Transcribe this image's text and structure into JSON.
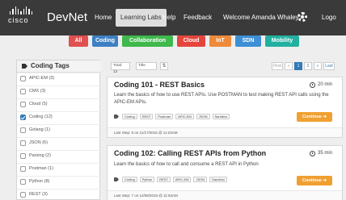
{
  "header": {
    "brand": "DevNet",
    "logo_text": "cisco",
    "nav": [
      "Home",
      "Learning Labs",
      "Help",
      "Feedback"
    ],
    "active_nav": "Learning Labs",
    "welcome": "Welcome Amanda Whaley",
    "logout": "Logo"
  },
  "categories": [
    {
      "label": "All",
      "color": "#e05050"
    },
    {
      "label": "Coding",
      "color": "#3d7fc4"
    },
    {
      "label": "Collaboration",
      "color": "#3fb84c"
    },
    {
      "label": "Cloud",
      "color": "#e5453d"
    },
    {
      "label": "IoT",
      "color": "#ef8a3a"
    },
    {
      "label": "SDN",
      "color": "#3d8fd6"
    },
    {
      "label": "Mobility",
      "color": "#22b0a0"
    }
  ],
  "sidebar": {
    "title": "Coding Tags",
    "items": [
      {
        "label": "APIC-EM (3)",
        "checked": false
      },
      {
        "label": "CMX (3)",
        "checked": false
      },
      {
        "label": "Cloud (5)",
        "checked": false
      },
      {
        "label": "Coding (12)",
        "checked": true
      },
      {
        "label": "Golang (1)",
        "checked": false
      },
      {
        "label": "JSON (6)",
        "checked": false
      },
      {
        "label": "Parsing (2)",
        "checked": false
      },
      {
        "label": "Postman (1)",
        "checked": false
      },
      {
        "label": "Python (8)",
        "checked": false
      },
      {
        "label": "REST (3)",
        "checked": false
      }
    ]
  },
  "toolbar": {
    "total": "Total: 12",
    "sort_select": "Title",
    "sort_icon": "⇅",
    "pagination": [
      "First",
      "«",
      "1",
      "2",
      "»",
      "Last"
    ],
    "current_page": "1"
  },
  "labs": [
    {
      "title": "Coding 101 - REST Basics",
      "duration": "20 min",
      "description": "Learn the basics of how to use REST APIs. Use POSTMAN to test making REST API calls using the APIC-EM APIs.",
      "tags": [
        "Coding",
        "REST",
        "Postman",
        "APIC-EM",
        "JSON",
        "Sandbox"
      ],
      "button": "Continue ➜",
      "last_step": "Last Step: 8 on 11/17/2015 @ 11:23AM"
    },
    {
      "title": "Coding 102: Calling REST APIs from Python",
      "duration": "35 min",
      "description": "Learn the basics of how to call and consume a REST API in Python",
      "tags": [
        "Coding",
        "Python",
        "REST",
        "APIC-EM",
        "JSON",
        "Sandbox"
      ],
      "button": "Continue ➜",
      "last_step": "Last Step: 7 on 12/08/2015 @ 11:53AM"
    }
  ]
}
